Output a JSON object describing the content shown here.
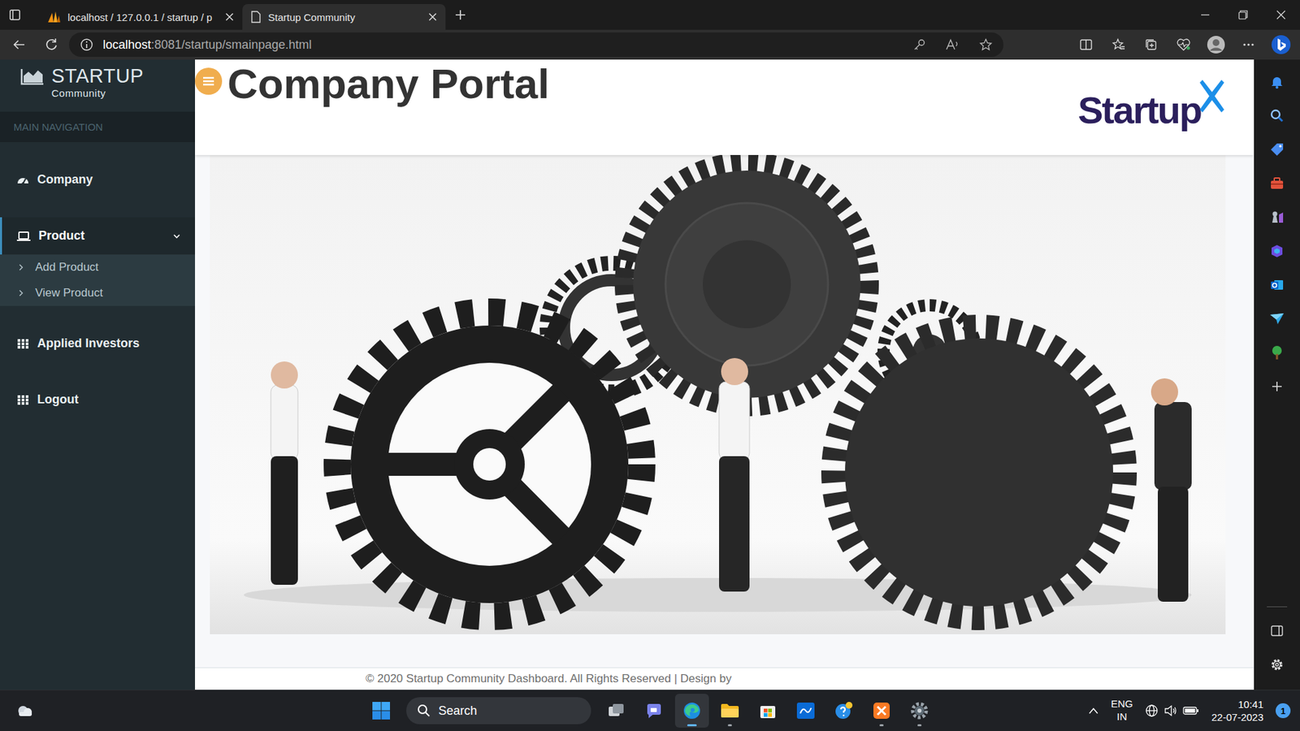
{
  "browser": {
    "tabs": [
      {
        "label": "localhost / 127.0.0.1 / startup / p",
        "selected": false
      },
      {
        "label": "Startup Community",
        "selected": true
      }
    ],
    "address": {
      "host": "localhost",
      "path": ":8081/startup/smainpage.html"
    }
  },
  "sidebar": {
    "brand": "STARTUP",
    "subtitle": "Community",
    "section": "MAIN NAVIGATION",
    "items": [
      {
        "label": "Company",
        "selected": false,
        "expanded": false,
        "children": []
      },
      {
        "label": "Product",
        "selected": true,
        "expanded": true,
        "children": [
          "Add Product",
          "View Product"
        ]
      },
      {
        "label": "Applied Investors",
        "selected": false,
        "expanded": false,
        "children": []
      },
      {
        "label": "Logout",
        "selected": false,
        "expanded": false,
        "children": []
      }
    ]
  },
  "header": {
    "title": "Company Portal",
    "logo": "Startup"
  },
  "footer": {
    "text": "© 2020 Startup Community Dashboard. All Rights Reserved | Design by"
  },
  "taskbar": {
    "search": "Search",
    "language": "ENG",
    "region": "IN",
    "time": "10:41",
    "date": "22-07-2023",
    "notifications": "1"
  }
}
